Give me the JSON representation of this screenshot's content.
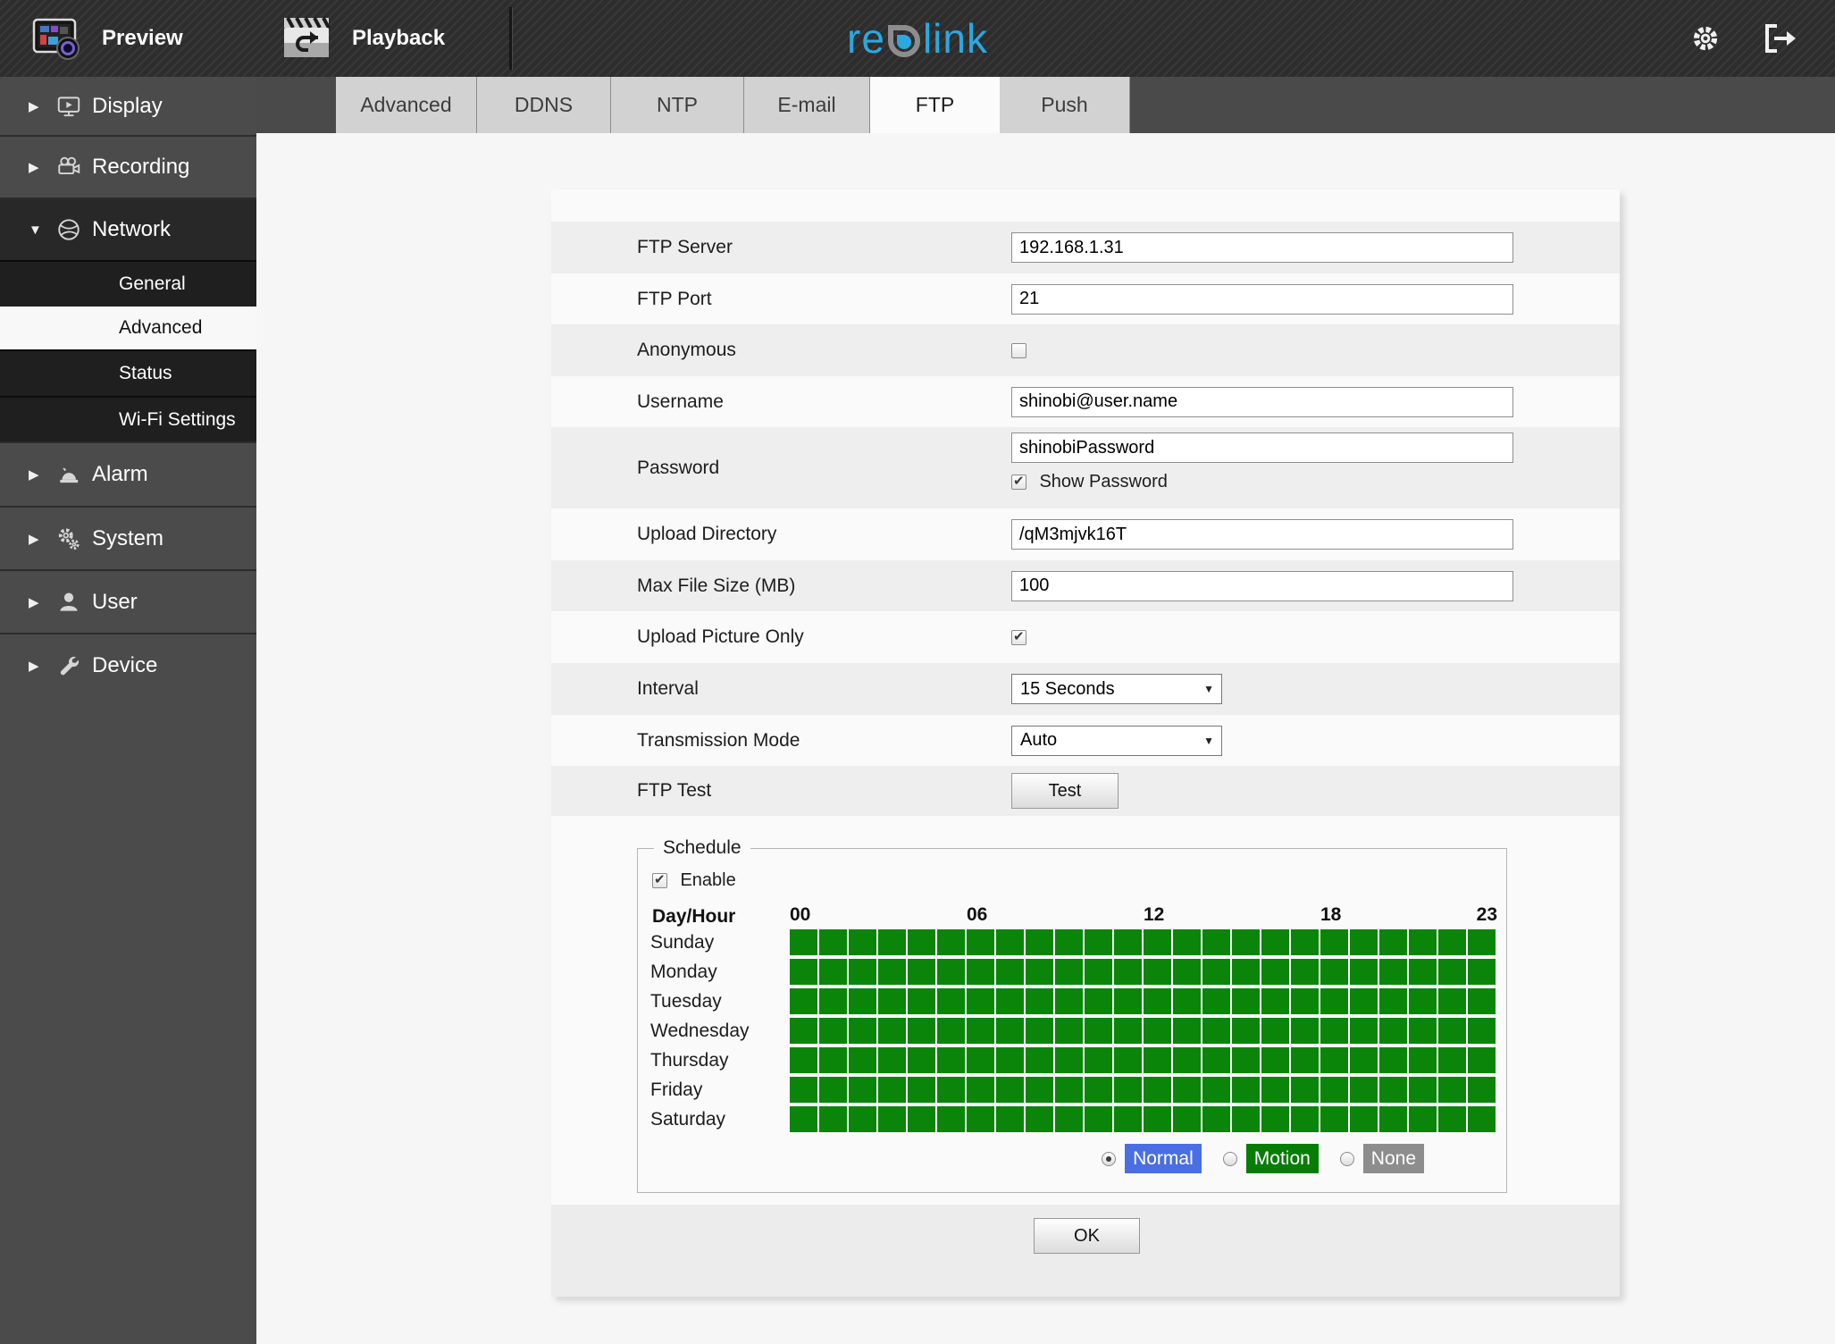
{
  "header": {
    "nav": [
      {
        "label": "Preview"
      },
      {
        "label": "Playback"
      }
    ],
    "logo": {
      "prefix": "re",
      "suffix": "link",
      "color": "#2BA8E0"
    }
  },
  "sidebar": {
    "items": [
      {
        "label": "Display"
      },
      {
        "label": "Recording"
      },
      {
        "label": "Network",
        "expanded": true,
        "children": [
          "General",
          "Advanced",
          "Status",
          "Wi-Fi Settings"
        ],
        "active_child": "Advanced"
      },
      {
        "label": "Alarm"
      },
      {
        "label": "System"
      },
      {
        "label": "User"
      },
      {
        "label": "Device"
      }
    ]
  },
  "tabs": {
    "items": [
      "Advanced",
      "DDNS",
      "NTP",
      "E-mail",
      "FTP",
      "Push"
    ],
    "active": "FTP"
  },
  "form": {
    "rows": [
      {
        "label": "FTP Server",
        "type": "text",
        "value": "192.168.1.31"
      },
      {
        "label": "FTP Port",
        "type": "text",
        "value": "21"
      },
      {
        "label": "Anonymous",
        "type": "checkbox",
        "checked": false
      },
      {
        "label": "Username",
        "type": "text",
        "value": "shinobi@user.name"
      },
      {
        "label": "Password",
        "type": "text",
        "value": "shinobiPassword",
        "extra_checkbox": {
          "label": "Show Password",
          "checked": true
        }
      },
      {
        "label": "Upload Directory",
        "type": "text",
        "value": "/qM3mjvk16T"
      },
      {
        "label": "Max File Size (MB)",
        "type": "text",
        "value": "100"
      },
      {
        "label": "Upload Picture Only",
        "type": "checkbox",
        "checked": true
      },
      {
        "label": "Interval",
        "type": "select",
        "value": "15 Seconds"
      },
      {
        "label": "Transmission Mode",
        "type": "select",
        "value": "Auto"
      },
      {
        "label": "FTP Test",
        "type": "button",
        "value": "Test"
      }
    ]
  },
  "schedule": {
    "legend": "Schedule",
    "enable_label": "Enable",
    "enable_checked": true,
    "corner_label": "Day/Hour",
    "hours": [
      "00",
      "06",
      "12",
      "18",
      "23"
    ],
    "days": [
      "Sunday",
      "Monday",
      "Tuesday",
      "Wednesday",
      "Thursday",
      "Friday",
      "Saturday"
    ],
    "grid": {
      "columns": 24,
      "rows": 7,
      "all_on": true,
      "on_color": "#0a850a"
    },
    "modes": [
      {
        "label": "Normal",
        "color": "#4a6fe3",
        "selected": true
      },
      {
        "label": "Motion",
        "color": "#077d07",
        "selected": false
      },
      {
        "label": "None",
        "color": "#8d8d8d",
        "selected": false
      }
    ]
  },
  "footer": {
    "ok_label": "OK"
  }
}
